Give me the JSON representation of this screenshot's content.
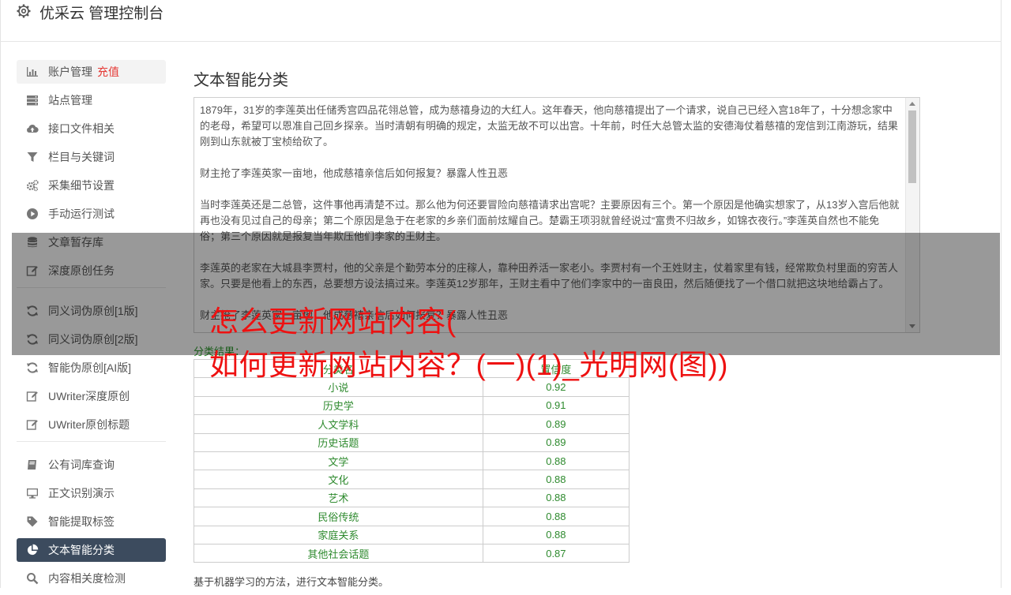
{
  "header": {
    "title": "优采云 管理控制台"
  },
  "sidebar": {
    "group1": [
      {
        "label": "账户管理",
        "tag": "充值",
        "icon": "bar-chart-icon"
      },
      {
        "label": "站点管理",
        "icon": "server-icon"
      },
      {
        "label": "接口文件相关",
        "icon": "cloud-upload-icon"
      },
      {
        "label": "栏目与关键词",
        "icon": "filter-icon"
      },
      {
        "label": "采集细节设置",
        "icon": "gears-icon"
      },
      {
        "label": "手动运行测试",
        "icon": "play-circle-icon"
      },
      {
        "label": "文章暂存库",
        "icon": "database-icon"
      },
      {
        "label": "深度原创任务",
        "icon": "edit-icon"
      }
    ],
    "group2": [
      {
        "label": "同义词伪原创[1版]",
        "icon": "refresh-icon"
      },
      {
        "label": "同义词伪原创[2版]",
        "icon": "refresh-icon"
      },
      {
        "label": "智能伪原创[AI版]",
        "icon": "refresh-icon"
      },
      {
        "label": "UWriter深度原创",
        "icon": "edit-icon"
      },
      {
        "label": "UWriter原创标题",
        "icon": "edit-icon"
      }
    ],
    "group3": [
      {
        "label": "公有词库查询",
        "icon": "book-icon"
      },
      {
        "label": "正文识别演示",
        "icon": "monitor-icon"
      },
      {
        "label": "智能提取标签",
        "icon": "tag-icon"
      },
      {
        "label": "文本智能分类",
        "icon": "pie-chart-icon"
      },
      {
        "label": "内容相关度检测",
        "icon": "search-icon"
      }
    ]
  },
  "main": {
    "title": "文本智能分类",
    "paragraphs": [
      "1879年，31岁的李莲英出任储秀宫四品花翎总管，成为慈禧身边的大红人。这年春天，他向慈禧提出了一个请求，说自己已经入宫18年了，十分想念家中的老母，希望可以恩准自己回乡探亲。当时清朝有明确的规定，太监无故不可以出宫。十年前，时任大总管太监的安德海仗着慈禧的宠信到江南游玩，结果刚到山东就被丁宝桢给砍了。",
      "财主抢了李莲英家一亩地，他成慈禧亲信后如何报复？暴露人性丑恶",
      "当时李莲英还是二总管，这件事他再清楚不过。那么他为何还要冒险向慈禧请求出宫呢？主要原因有三个。第一个原因是他确实想家了，从13岁入宫后他就再也没有见过自己的母亲；第二个原因是急于在老家的乡亲们面前炫耀自己。楚霸王项羽就曾经说过“富贵不归故乡，如锦衣夜行。”李莲英自然也不能免俗；第三个原因就是报复当年欺压他们李家的王财主。",
      "李莲英的老家在大城县李贾村，他的父亲是个勤劳本分的庄稼人，靠种田养活一家老小。李贾村有一个王姓财主，仗着家里有钱，经常欺负村里面的穷苦人家。只要是他看上的东西，总要想方设法搞过来。李莲英12岁那年，王财主看中了他们李家中的一亩良田，然后随便找了一个借口就把这块地给霸占了。",
      "财主抢了李莲英家一亩地，他成慈禧亲信后如何报复？暴露人性丑恶"
    ],
    "result_label": "分类结果：",
    "table": {
      "headers": [
        "分类名",
        "置信度"
      ],
      "rows": [
        [
          "小说",
          "0.92"
        ],
        [
          "历史学",
          "0.91"
        ],
        [
          "人文学科",
          "0.89"
        ],
        [
          "历史话题",
          "0.89"
        ],
        [
          "文学",
          "0.88"
        ],
        [
          "文化",
          "0.88"
        ],
        [
          "艺术",
          "0.88"
        ],
        [
          "民俗传统",
          "0.88"
        ],
        [
          "家庭关系",
          "0.88"
        ],
        [
          "其他社会话题",
          "0.87"
        ]
      ]
    },
    "footnote": "基于机器学习的方法，进行文本智能分类。"
  },
  "watermark": {
    "line1": "怎么更新网站内容(",
    "line2": "如何更新网站内容？(一)(1)_光明网(图))"
  },
  "colors": {
    "active_bg": "#3c4b5e",
    "accent_red": "#e53935",
    "table_text": "#2e8a2e",
    "watermark": "#ee1111"
  }
}
